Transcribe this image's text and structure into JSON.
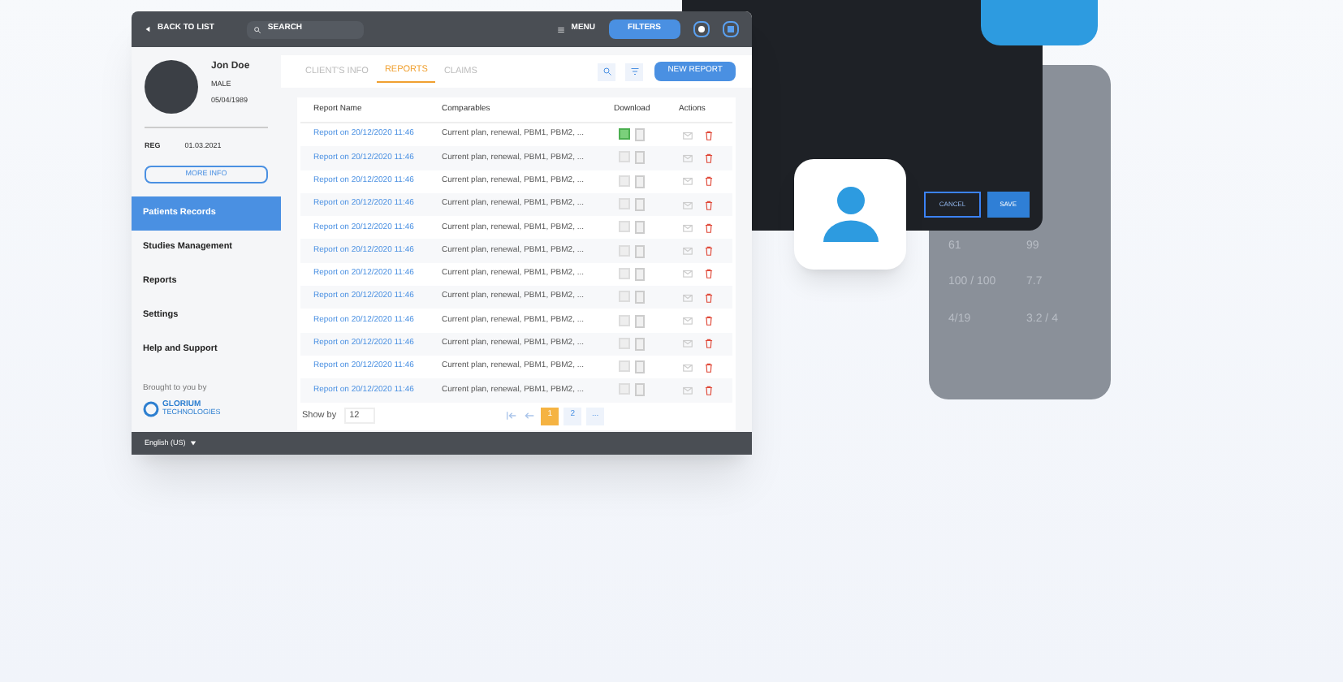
{
  "header": {
    "back": "BACK TO LIST",
    "search_placeholder": "SEARCH",
    "menu": "MENU",
    "filters": "FILTERS"
  },
  "patient": {
    "name": "Jon Doe",
    "sex": "MALE",
    "birth_date": "05/04/1989",
    "reg_label": "REG",
    "reg_date": "01.03.2021",
    "more_info": "MORE INFO"
  },
  "sidebar": {
    "items": [
      {
        "label": "Patients Records",
        "selected": true
      },
      {
        "label": "Studies Management",
        "selected": false
      },
      {
        "label": "Reports",
        "selected": false
      },
      {
        "label": "Settings",
        "selected": false
      },
      {
        "label": "Help and Support",
        "selected": false
      }
    ],
    "brought_by": "Brought to you by",
    "logo_name": "GLORIUM",
    "logo_sub": "TECHNOLOGIES"
  },
  "tabs": [
    {
      "label": "CLIENT'S INFO",
      "selected": false
    },
    {
      "label": "REPORTS",
      "selected": true
    },
    {
      "label": "CLAIMS",
      "selected": false
    }
  ],
  "new_report": "NEW REPORT",
  "table": {
    "columns": [
      "Report Name",
      "Comparables",
      "Download",
      "Actions"
    ],
    "rows": [
      {
        "name": "Report on 20/12/2020 11:46",
        "comparables": "Current plan, renewal, PBM1, PBM2, ...",
        "selected": true
      },
      {
        "name": "Report on 20/12/2020 11:46",
        "comparables": "Current plan, renewal, PBM1, PBM2, ...",
        "selected": false
      },
      {
        "name": "Report on 20/12/2020 11:46",
        "comparables": "Current plan, renewal, PBM1, PBM2, ...",
        "selected": false
      },
      {
        "name": "Report on 20/12/2020 11:46",
        "comparables": "Current plan, renewal, PBM1, PBM2, ...",
        "selected": false
      },
      {
        "name": "Report on 20/12/2020 11:46",
        "comparables": "Current plan, renewal, PBM1, PBM2, ...",
        "selected": false
      },
      {
        "name": "Report on 20/12/2020 11:46",
        "comparables": "Current plan, renewal, PBM1, PBM2, ...",
        "selected": false
      },
      {
        "name": "Report on 20/12/2020 11:46",
        "comparables": "Current plan, renewal, PBM1, PBM2, ...",
        "selected": false
      },
      {
        "name": "Report on 20/12/2020 11:46",
        "comparables": "Current plan, renewal, PBM1, PBM2, ...",
        "selected": false
      },
      {
        "name": "Report on 20/12/2020 11:46",
        "comparables": "Current plan, renewal, PBM1, PBM2, ...",
        "selected": false
      },
      {
        "name": "Report on 20/12/2020 11:46",
        "comparables": "Current plan, renewal, PBM1, PBM2, ...",
        "selected": false
      },
      {
        "name": "Report on 20/12/2020 11:46",
        "comparables": "Current plan, renewal, PBM1, PBM2, ...",
        "selected": false
      },
      {
        "name": "Report on 20/12/2020 11:46",
        "comparables": "Current plan, renewal, PBM1, PBM2, ...",
        "selected": false
      }
    ]
  },
  "show_by": {
    "label": "Show by",
    "value": "12"
  },
  "pagination": [
    {
      "label": "1",
      "selected": true
    },
    {
      "label": "2",
      "selected": false
    },
    {
      "label": "...",
      "selected": false
    }
  ],
  "language": "English (US)",
  "dark_panel": {
    "cancel": "CANCEL",
    "save": "SAVE"
  },
  "phone": {
    "values": [
      "61",
      "99",
      "100 / 100",
      "7.7",
      "4/19",
      "3.2 / 4"
    ]
  }
}
